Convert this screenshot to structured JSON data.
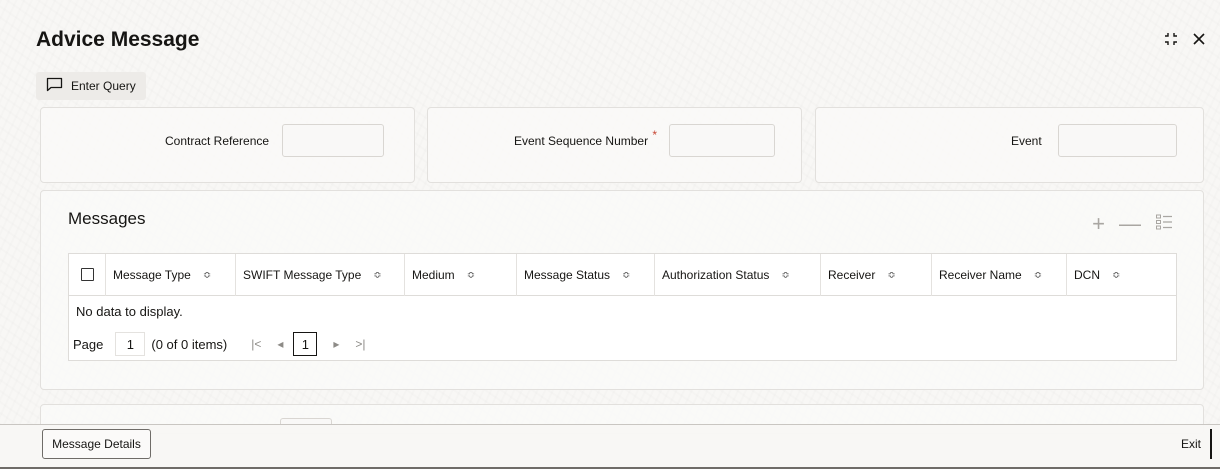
{
  "window": {
    "title": "Advice Message"
  },
  "toolbar": {
    "enter_query_label": "Enter Query"
  },
  "fields": {
    "contract_reference": {
      "label": "Contract Reference",
      "value": ""
    },
    "event_sequence_number": {
      "label": "Event Sequence Number",
      "required": "*",
      "value": ""
    },
    "event": {
      "label": "Event",
      "value": ""
    }
  },
  "messages": {
    "title": "Messages",
    "columns": [
      {
        "label": "Message Type"
      },
      {
        "label": "SWIFT Message Type"
      },
      {
        "label": "Medium"
      },
      {
        "label": "Message Status"
      },
      {
        "label": "Authorization Status"
      },
      {
        "label": "Receiver"
      },
      {
        "label": "Receiver Name"
      },
      {
        "label": "DCN"
      }
    ],
    "empty_text": "No data to display.",
    "pager": {
      "page_label": "Page",
      "page_input": "1",
      "items_text": "(0 of 0 items)",
      "current_page": "1"
    }
  },
  "footer": {
    "message_details_label": "Message Details",
    "exit_label": "Exit"
  },
  "colors": {
    "required": "#c74634",
    "text": "#161513",
    "border": "#dedcd9"
  }
}
